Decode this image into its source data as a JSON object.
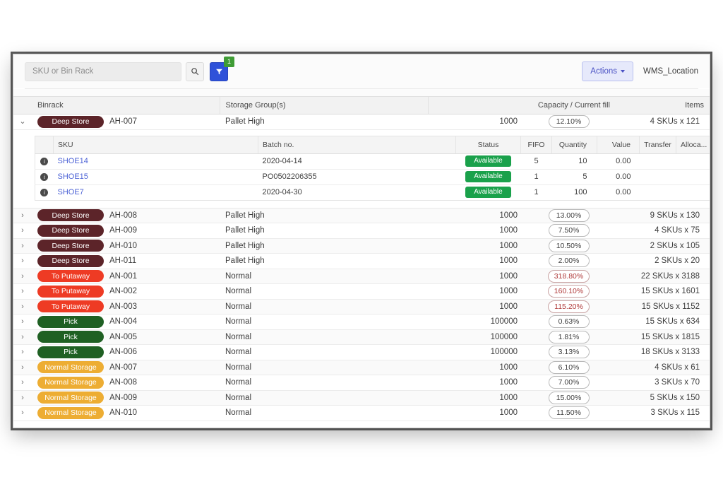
{
  "toolbar": {
    "search_placeholder": "SKU or Bin Rack",
    "search_value": "",
    "search_icon": "search-icon",
    "filter_icon": "filter-funnel-icon",
    "filter_badge_count": "1",
    "actions_label": "Actions",
    "location_label": "WMS_Location"
  },
  "outer_table": {
    "columns": [
      "Binrack",
      "Storage Group(s)",
      "Capacity / Current fill",
      "Items"
    ],
    "rows": [
      {
        "expanded": true,
        "chevron": "v",
        "tag": "Deep Store",
        "tag_type": "deep",
        "code": "AH-007",
        "storage_group": "Pallet High",
        "capacity": "1000",
        "fill": "12.10%",
        "over": false,
        "items": "4 SKUs x 121"
      },
      {
        "expanded": false,
        "chevron": ">",
        "tag": "Deep Store",
        "tag_type": "deep",
        "code": "AH-008",
        "storage_group": "Pallet High",
        "capacity": "1000",
        "fill": "13.00%",
        "over": false,
        "items": "9 SKUs x 130"
      },
      {
        "expanded": false,
        "chevron": ">",
        "tag": "Deep Store",
        "tag_type": "deep",
        "code": "AH-009",
        "storage_group": "Pallet High",
        "capacity": "1000",
        "fill": "7.50%",
        "over": false,
        "items": "4 SKUs x 75"
      },
      {
        "expanded": false,
        "chevron": ">",
        "tag": "Deep Store",
        "tag_type": "deep",
        "code": "AH-010",
        "storage_group": "Pallet High",
        "capacity": "1000",
        "fill": "10.50%",
        "over": false,
        "items": "2 SKUs x 105"
      },
      {
        "expanded": false,
        "chevron": ">",
        "tag": "Deep Store",
        "tag_type": "deep",
        "code": "AH-011",
        "storage_group": "Pallet High",
        "capacity": "1000",
        "fill": "2.00%",
        "over": false,
        "items": "2 SKUs x 20"
      },
      {
        "expanded": false,
        "chevron": ">",
        "tag": "To Putaway",
        "tag_type": "put",
        "code": "AN-001",
        "storage_group": "Normal",
        "capacity": "1000",
        "fill": "318.80%",
        "over": true,
        "items": "22 SKUs x 3188"
      },
      {
        "expanded": false,
        "chevron": ">",
        "tag": "To Putaway",
        "tag_type": "put",
        "code": "AN-002",
        "storage_group": "Normal",
        "capacity": "1000",
        "fill": "160.10%",
        "over": true,
        "items": "15 SKUs x 1601"
      },
      {
        "expanded": false,
        "chevron": ">",
        "tag": "To Putaway",
        "tag_type": "put",
        "code": "AN-003",
        "storage_group": "Normal",
        "capacity": "1000",
        "fill": "115.20%",
        "over": true,
        "items": "15 SKUs x 1152"
      },
      {
        "expanded": false,
        "chevron": ">",
        "tag": "Pick",
        "tag_type": "pick",
        "code": "AN-004",
        "storage_group": "Normal",
        "capacity": "100000",
        "fill": "0.63%",
        "over": false,
        "items": "15 SKUs x 634"
      },
      {
        "expanded": false,
        "chevron": ">",
        "tag": "Pick",
        "tag_type": "pick",
        "code": "AN-005",
        "storage_group": "Normal",
        "capacity": "100000",
        "fill": "1.81%",
        "over": false,
        "items": "15 SKUs x 1815"
      },
      {
        "expanded": false,
        "chevron": ">",
        "tag": "Pick",
        "tag_type": "pick",
        "code": "AN-006",
        "storage_group": "Normal",
        "capacity": "100000",
        "fill": "3.13%",
        "over": false,
        "items": "18 SKUs x 3133"
      },
      {
        "expanded": false,
        "chevron": ">",
        "tag": "Normal Storage",
        "tag_type": "normal",
        "code": "AN-007",
        "storage_group": "Normal",
        "capacity": "1000",
        "fill": "6.10%",
        "over": false,
        "items": "4 SKUs x 61"
      },
      {
        "expanded": false,
        "chevron": ">",
        "tag": "Normal Storage",
        "tag_type": "normal",
        "code": "AN-008",
        "storage_group": "Normal",
        "capacity": "1000",
        "fill": "7.00%",
        "over": false,
        "items": "3 SKUs x 70"
      },
      {
        "expanded": false,
        "chevron": ">",
        "tag": "Normal Storage",
        "tag_type": "normal",
        "code": "AN-009",
        "storage_group": "Normal",
        "capacity": "1000",
        "fill": "15.00%",
        "over": false,
        "items": "5 SKUs x 150"
      },
      {
        "expanded": false,
        "chevron": ">",
        "tag": "Normal Storage",
        "tag_type": "normal",
        "code": "AN-010",
        "storage_group": "Normal",
        "capacity": "1000",
        "fill": "11.50%",
        "over": false,
        "items": "3 SKUs x 115"
      }
    ]
  },
  "inner_table": {
    "columns": [
      "SKU",
      "Batch no.",
      "Status",
      "FIFO",
      "Quantity",
      "Value",
      "Transfer",
      "Alloca..."
    ],
    "rows": [
      {
        "info_icon": "info-circle-icon",
        "sku": "SHOE14",
        "batch": "2020-04-14",
        "status": "Available",
        "fifo": "5",
        "quantity": "10",
        "value": "0.00",
        "transfer": "",
        "alloc": "",
        "action_icon": "transfer-arrows-icon"
      },
      {
        "info_icon": "info-circle-icon",
        "sku": "SHOE15",
        "batch": "PO0502206355",
        "status": "Available",
        "fifo": "1",
        "quantity": "5",
        "value": "0.00",
        "transfer": "",
        "alloc": "",
        "action_icon": "transfer-arrows-icon"
      },
      {
        "info_icon": "info-circle-icon",
        "sku": "SHOE7",
        "batch": "2020-04-30",
        "status": "Available",
        "fifo": "1",
        "quantity": "100",
        "value": "0.00",
        "transfer": "",
        "alloc": "",
        "action_icon": "transfer-arrows-icon"
      }
    ]
  },
  "colors": {
    "tag_deep_store": "#5c2429",
    "tag_to_putaway": "#ee3b24",
    "tag_pick": "#1f6023",
    "tag_normal_storage": "#edad33",
    "status_available": "#1aa14b",
    "filter_button": "#2f52d9",
    "filter_badge": "#3f9c35",
    "actions_accent": "#4b52c4",
    "over_capacity": "#b03a3a",
    "sku_link": "#4d63d6"
  }
}
